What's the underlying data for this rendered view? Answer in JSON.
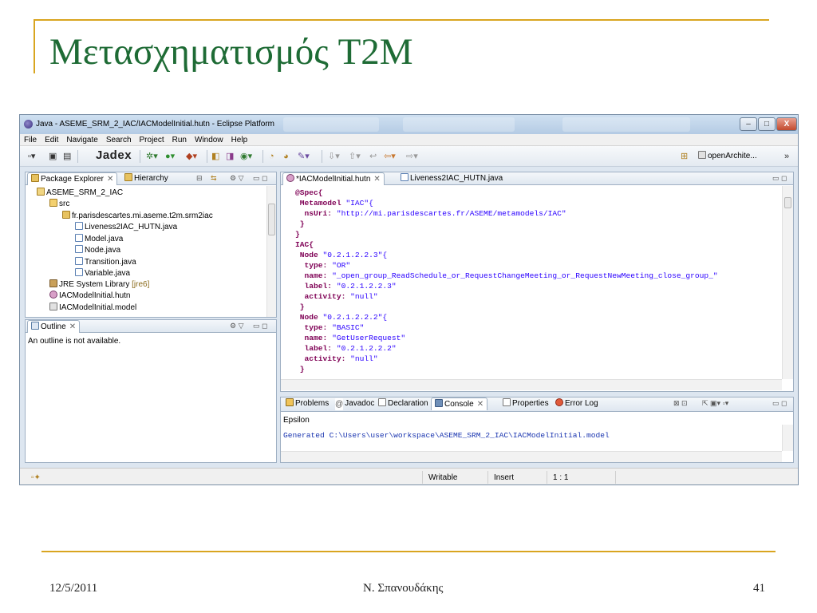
{
  "slide": {
    "title": "Μετασχηματισμός T2M",
    "date": "12/5/2011",
    "author": "Ν. Σπανουδάκης",
    "page_number": "41",
    "accent_color": "#d9a520",
    "title_color": "#1e6b35"
  },
  "window": {
    "title": "Java - ASEME_SRM_2_IAC/IACModelInitial.hutn - Eclipse Platform",
    "controls": {
      "minimize": "–",
      "maximize": "□",
      "close": "X"
    }
  },
  "menu": [
    "File",
    "Edit",
    "Navigate",
    "Search",
    "Project",
    "Run",
    "Window",
    "Help"
  ],
  "toolbar": {
    "jadex_label": "Jadex",
    "perspective_label": "openArchite...",
    "overflow": "»"
  },
  "package_explorer": {
    "tabs": [
      {
        "label": "Package Explorer",
        "close": "✕",
        "icon": "package-explorer-icon"
      },
      {
        "label": "Hierarchy",
        "icon": "hierarchy-icon"
      }
    ],
    "tree": [
      {
        "label": "ASEME_SRM_2_IAC",
        "icon": "project-icon"
      },
      {
        "label": "src",
        "icon": "source-folder-icon"
      },
      {
        "label": "fr.parisdescartes.mi.aseme.t2m.srm2iac",
        "icon": "package-icon"
      },
      {
        "label": "Liveness2IAC_HUTN.java",
        "icon": "java-file-icon"
      },
      {
        "label": "Model.java",
        "icon": "java-file-icon"
      },
      {
        "label": "Node.java",
        "icon": "java-file-icon"
      },
      {
        "label": "Transition.java",
        "icon": "java-file-icon"
      },
      {
        "label": "Variable.java",
        "icon": "java-file-icon"
      },
      {
        "label": "JRE System Library",
        "suffix": "[jre6]",
        "icon": "library-icon"
      },
      {
        "label": "IACModelInitial.hutn",
        "icon": "hutn-file-icon"
      },
      {
        "label": "IACModelInitial.model",
        "icon": "model-file-icon"
      }
    ]
  },
  "outline": {
    "tab_label": "Outline",
    "close": "✕",
    "message": "An outline is not available."
  },
  "editor": {
    "tabs": [
      {
        "label": "*IACModelInitial.hutn",
        "close": "✕"
      },
      {
        "label": "Liveness2IAC_HUTN.java"
      }
    ],
    "lines": [
      {
        "k": "@Spec{",
        "s": ""
      },
      {
        "k": " Metamodel ",
        "s": "\"IAC\"{"
      },
      {
        "k": "  nsUri: ",
        "s": "\"http://mi.parisdescartes.fr/ASEME/metamodels/IAC\""
      },
      {
        "k": " }",
        "s": ""
      },
      {
        "k": "}",
        "s": ""
      },
      {
        "k": "IAC{",
        "s": ""
      },
      {
        "k": " Node ",
        "s": "\"0.2.1.2.2.3\"{"
      },
      {
        "k": "  type: ",
        "s": "\"OR\""
      },
      {
        "k": "  name: ",
        "s": "\"_open_group_ReadSchedule_or_RequestChangeMeeting_or_RequestNewMeeting_close_group_\""
      },
      {
        "k": "  label: ",
        "s": "\"0.2.1.2.2.3\""
      },
      {
        "k": "  activity: ",
        "s": "\"null\""
      },
      {
        "k": " }",
        "s": ""
      },
      {
        "k": " Node ",
        "s": "\"0.2.1.2.2.2\"{"
      },
      {
        "k": "  type: ",
        "s": "\"BASIC\""
      },
      {
        "k": "  name: ",
        "s": "\"GetUserRequest\""
      },
      {
        "k": "  label: ",
        "s": "\"0.2.1.2.2.2\""
      },
      {
        "k": "  activity: ",
        "s": "\"null\""
      },
      {
        "k": " }",
        "s": ""
      }
    ]
  },
  "bottom_panel": {
    "tabs": [
      {
        "label": "Problems",
        "icon": "problems-icon"
      },
      {
        "label": "Javadoc",
        "icon": "javadoc-icon"
      },
      {
        "label": "Declaration",
        "icon": "declaration-icon"
      },
      {
        "label": "Console",
        "close": "✕",
        "icon": "console-icon"
      },
      {
        "label": "Properties",
        "icon": "properties-icon"
      },
      {
        "label": "Error Log",
        "icon": "error-log-icon"
      }
    ],
    "console_name": "Epsilon",
    "console_output": "Generated C:\\Users\\user\\workspace\\ASEME_SRM_2_IAC\\IACModelInitial.model"
  },
  "status": {
    "writable": "Writable",
    "insert_mode": "Insert",
    "position": "1 : 1"
  }
}
